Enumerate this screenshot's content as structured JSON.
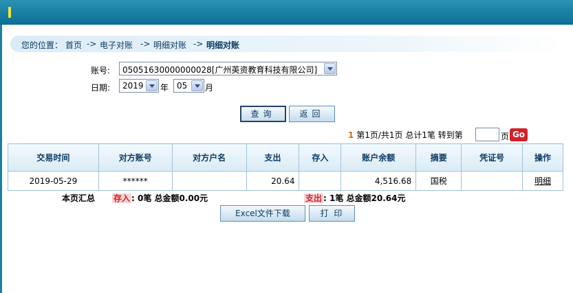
{
  "breadcrumb": {
    "prefix": "您的位置：",
    "items": [
      "首页",
      "电子对账",
      "明细对账"
    ],
    "current": "明细对账",
    "separator": "->"
  },
  "form": {
    "account_label": "账号:",
    "account_value": "05051630000000028[广州英资教育科技有限公司]",
    "date_label": "日期:",
    "year_value": "2019",
    "year_unit": "年",
    "month_value": "05",
    "month_unit": "月",
    "query_label": "查询",
    "back_label": "返回"
  },
  "pager": {
    "current": "1",
    "text": "第1页/共1页  总计1笔  转到第",
    "page_suffix": "页",
    "go_label": "Go",
    "goto_value": ""
  },
  "table": {
    "headers": [
      "交易时间",
      "对方账号",
      "对方户名",
      "支出",
      "存入",
      "账户余额",
      "摘要",
      "凭证号",
      "操作"
    ],
    "rows": [
      {
        "time": "2019-05-29",
        "counter_account": "******",
        "counter_name": "",
        "expense": "20.64",
        "income": "",
        "balance": "4,516.68",
        "summary": "国税",
        "voucher": "",
        "action": "明细"
      }
    ]
  },
  "summary": {
    "label": "本页汇总",
    "income_tag": "存入",
    "income_text": ":  0笔  总金额0.00元",
    "expense_tag": "支出",
    "expense_text": ":  1笔  总金额20.64元"
  },
  "actions": {
    "excel_label": "Excel文件下载",
    "print_label": "打 印"
  }
}
